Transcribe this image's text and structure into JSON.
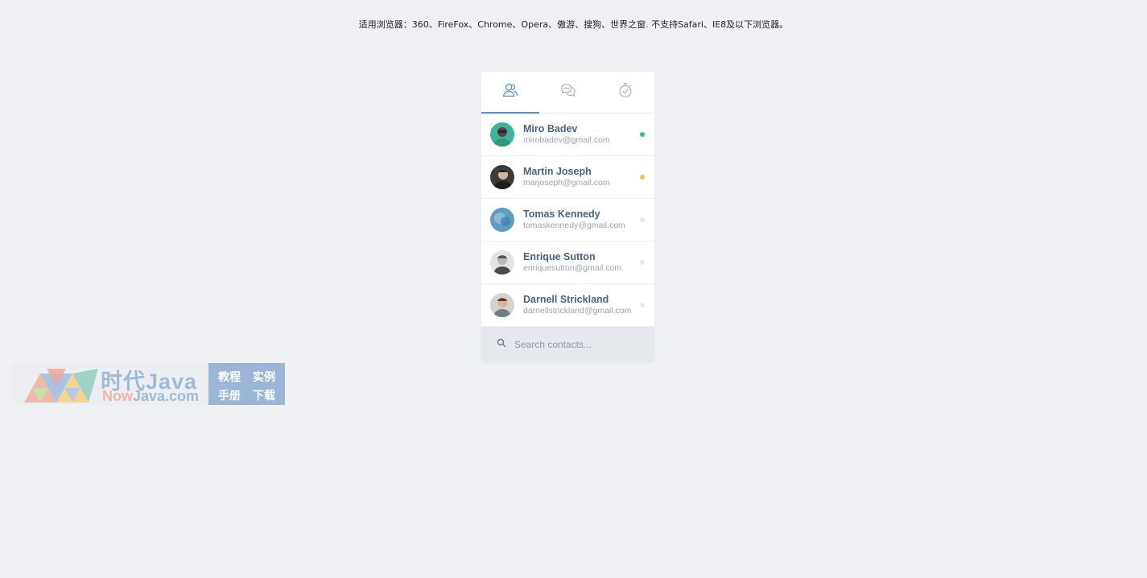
{
  "notice": "适用浏览器：360、FireFox、Chrome、Opera、傲游、搜狗、世界之窗. 不支持Safari、IE8及以下浏览器。",
  "tabs": [
    {
      "icon": "users-icon",
      "active": true
    },
    {
      "icon": "chat-icon",
      "active": false
    },
    {
      "icon": "timer-icon",
      "active": false
    }
  ],
  "colors": {
    "accent": "#4a90e2",
    "online": "#2ecc71",
    "away": "#f5c542",
    "offline": "#e5e8ec"
  },
  "contacts": [
    {
      "name": "Miro Badev",
      "email": "mirobadev@gmail.com",
      "status": "online"
    },
    {
      "name": "Martin Joseph",
      "email": "marjoseph@gmail.com",
      "status": "away"
    },
    {
      "name": "Tomas Kennedy",
      "email": "tomaskennedy@gmail.com",
      "status": "offline"
    },
    {
      "name": "Enrique Sutton",
      "email": "enriquesutton@gmail.com",
      "status": "offline"
    },
    {
      "name": "Darnell Strickland",
      "email": "darnellstrickland@gmail.com",
      "status": "offline"
    }
  ],
  "search": {
    "placeholder": "Search contacts..."
  },
  "watermark": {
    "cn_title": "时代Java",
    "en_prefix": "Now",
    "en_rest": "Java.com",
    "tags": [
      "教程",
      "实例",
      "手册",
      "下载"
    ]
  }
}
